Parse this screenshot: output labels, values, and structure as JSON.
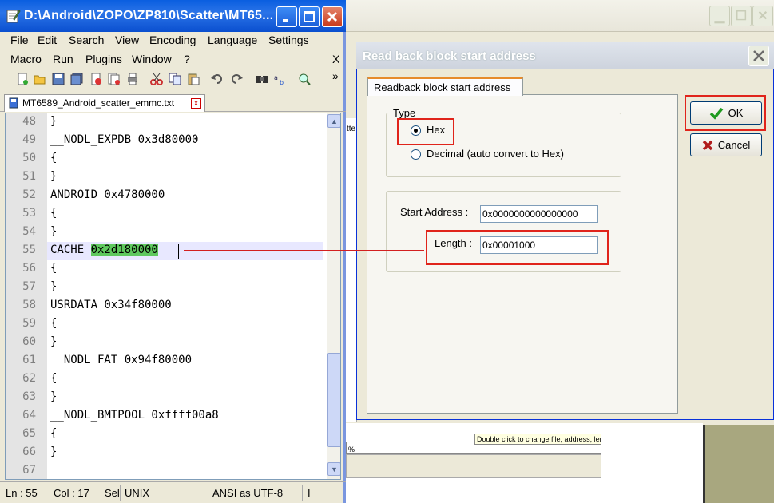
{
  "npp": {
    "title": "D:\\Android\\ZOPO\\ZP810\\Scatter\\MT65...",
    "menu_row1": [
      "File",
      "Edit",
      "Search",
      "View",
      "Encoding",
      "Language",
      "Settings"
    ],
    "menu_row2": [
      "Macro",
      "Run",
      "Plugins",
      "Window",
      "?"
    ],
    "menu_close": "X",
    "toolbar_more": "»",
    "tab_label": "MT6589_Android_scatter_emmc.txt",
    "lines": [
      {
        "n": "48",
        "text": "}"
      },
      {
        "n": "49",
        "text": "__NODL_EXPDB 0x3d80000"
      },
      {
        "n": "50",
        "text": "{"
      },
      {
        "n": "51",
        "text": "}"
      },
      {
        "n": "52",
        "text": "ANDROID 0x4780000"
      },
      {
        "n": "53",
        "text": "{"
      },
      {
        "n": "54",
        "text": "}"
      },
      {
        "n": "55",
        "text": "CACHE ",
        "selected": "0x2d180000"
      },
      {
        "n": "56",
        "text": "{"
      },
      {
        "n": "57",
        "text": "}"
      },
      {
        "n": "58",
        "text": "USRDATA 0x34f80000"
      },
      {
        "n": "59",
        "text": "{"
      },
      {
        "n": "60",
        "text": "}"
      },
      {
        "n": "61",
        "text": "__NODL_FAT 0x94f80000"
      },
      {
        "n": "62",
        "text": "{"
      },
      {
        "n": "63",
        "text": "}"
      },
      {
        "n": "64",
        "text": "__NODL_BMTPOOL 0xffff00a8"
      },
      {
        "n": "65",
        "text": "{"
      },
      {
        "n": "66",
        "text": "}"
      },
      {
        "n": "67",
        "text": ""
      }
    ],
    "status": {
      "ln": "Ln : 55",
      "col": "Col : 17",
      "sel": "Sel",
      "eol": "UNIX",
      "encoding": "ANSI as UTF-8",
      "ins": "I"
    }
  },
  "dialog": {
    "title": "Read back block start address",
    "tab": "Readback block start address",
    "type_group_label": "Type",
    "radio_hex": "Hex",
    "radio_decimal": "Decimal (auto convert to Hex)",
    "selected_type": "Hex",
    "start_address_label": "Start Address :",
    "start_address_value": "0x0000000000000000",
    "length_label": "Length :",
    "length_value": "0x00001000",
    "ok_label": "OK",
    "cancel_label": "Cancel"
  },
  "background": {
    "tooltip": "Double click to change file, address, lengt",
    "strip_text": "tte",
    "list_text": "%"
  },
  "colors": {
    "selection_highlight": "#5ec85e",
    "annotation_red": "#e0241b",
    "titlebar_blue": "#0a5ee0"
  }
}
